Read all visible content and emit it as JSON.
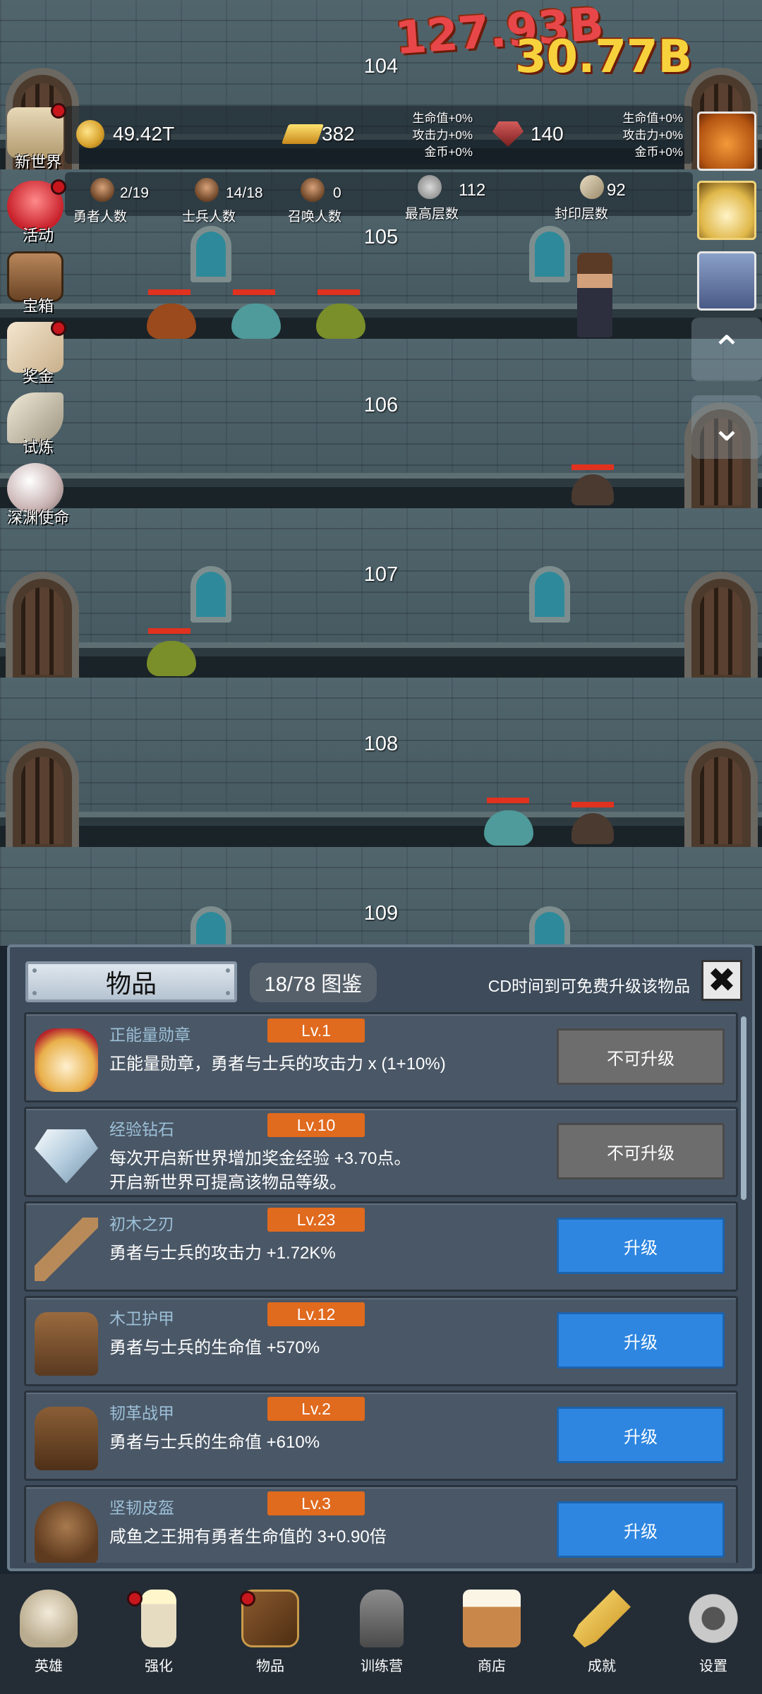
{
  "floors": [
    {
      "number": "104"
    },
    {
      "number": "105"
    },
    {
      "number": "106"
    },
    {
      "number": "107"
    },
    {
      "number": "108"
    },
    {
      "number": "109"
    }
  ],
  "damage": {
    "line1": "127.93B",
    "line2": "30.77B"
  },
  "resources": {
    "gold": "49.42T",
    "gold_bars": "382",
    "gems": "140",
    "bonus_left": {
      "hp": "生命值+0%",
      "atk": "攻击力+0%",
      "coin": "金币+0%"
    },
    "bonus_right": {
      "hp": "生命值+0%",
      "atk": "攻击力+0%",
      "coin": "金币+0%"
    }
  },
  "stats": {
    "heroes": {
      "value": "2/19",
      "label": "勇者人数"
    },
    "soldiers": {
      "value": "14/18",
      "label": "士兵人数"
    },
    "summons": {
      "value": "0",
      "label": "召唤人数"
    },
    "max_floor": {
      "value": "112",
      "label": "最高层数"
    },
    "seal_floor": {
      "value": "92",
      "label": "封印层数"
    }
  },
  "side_menu": [
    {
      "label": "新世界",
      "icon": "scroll-map-icon",
      "dot": true
    },
    {
      "label": "活动",
      "icon": "heart-icon",
      "dot": true
    },
    {
      "label": "宝箱",
      "icon": "chest-icon",
      "dot": false
    },
    {
      "label": "奖金",
      "icon": "envelope-icon",
      "dot": true
    },
    {
      "label": "试炼",
      "icon": "feather-icon",
      "dot": false
    },
    {
      "label": "深渊使命",
      "icon": "orb-icon",
      "dot": false
    }
  ],
  "panel": {
    "title": "物品",
    "collection": "18/78 图鉴",
    "cd_note": "CD时间到可免费升级该物品",
    "close": "✖"
  },
  "items": [
    {
      "name": "正能量勋章",
      "level": "Lv.1",
      "desc": "正能量勋章，勇者与士兵的攻击力 x (1+10%)",
      "desc2": "",
      "button": "不可升级",
      "enabled": false,
      "icon": "crown-medal-icon"
    },
    {
      "name": "经验钻石",
      "level": "Lv.10",
      "desc": "每次开启新世界增加奖金经验 +3.70点。",
      "desc2": "开启新世界可提高该物品等级。",
      "button": "不可升级",
      "enabled": false,
      "icon": "diamond-icon"
    },
    {
      "name": "初木之刃",
      "level": "Lv.23",
      "desc": "勇者与士兵的攻击力 +1.72K%",
      "desc2": "",
      "button": "升级",
      "enabled": true,
      "icon": "wooden-sword-icon"
    },
    {
      "name": "木卫护甲",
      "level": "Lv.12",
      "desc": "勇者与士兵的生命值 +570%",
      "desc2": "",
      "button": "升级",
      "enabled": true,
      "icon": "wooden-armor-icon"
    },
    {
      "name": "韧革战甲",
      "level": "Lv.2",
      "desc": "勇者与士兵的生命值 +610%",
      "desc2": "",
      "button": "升级",
      "enabled": true,
      "icon": "leather-armor-icon"
    },
    {
      "name": "坚韧皮盔",
      "level": "Lv.3",
      "desc": "咸鱼之王拥有勇者生命值的 3+0.90倍",
      "desc2": "",
      "button": "升级",
      "enabled": true,
      "icon": "leather-helmet-icon"
    }
  ],
  "bottom_nav": [
    {
      "label": "英雄",
      "icon": "skull-icon",
      "dot": false
    },
    {
      "label": "强化",
      "icon": "candle-icon",
      "dot": true
    },
    {
      "label": "物品",
      "icon": "book-icon",
      "dot": true
    },
    {
      "label": "训练营",
      "icon": "lantern-icon",
      "dot": false
    },
    {
      "label": "商店",
      "icon": "beer-mug-icon",
      "dot": false
    },
    {
      "label": "成就",
      "icon": "key-icon",
      "dot": false
    },
    {
      "label": "设置",
      "icon": "gear-icon",
      "dot": false
    }
  ],
  "right_buttons": {
    "up": "⌃",
    "down": "⌄"
  }
}
